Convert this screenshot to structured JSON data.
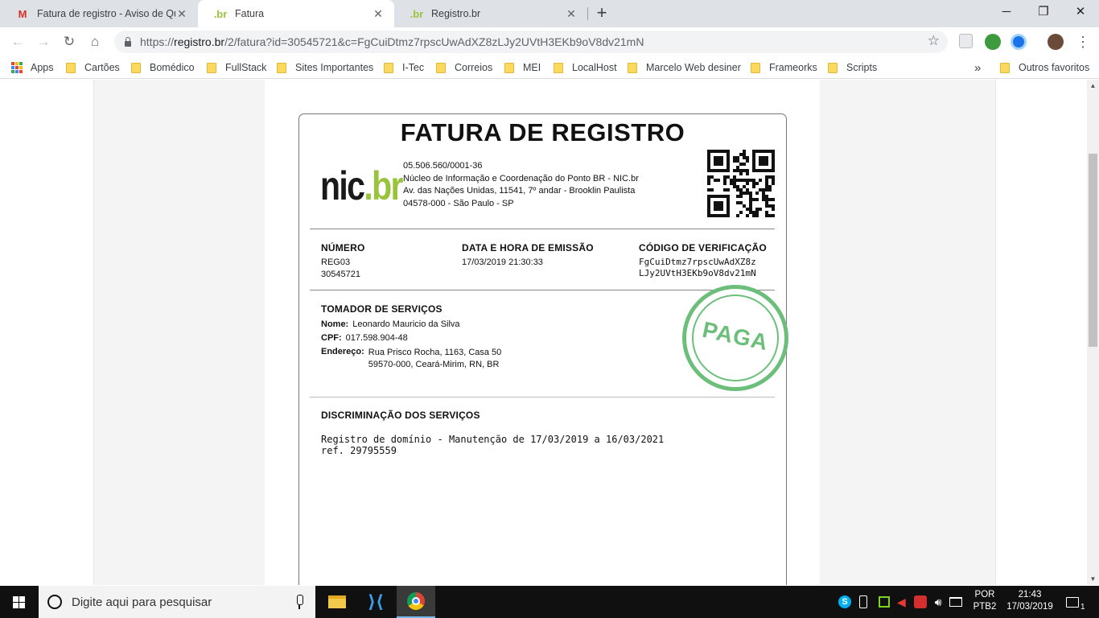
{
  "browser": {
    "tabs": [
      {
        "title": "Fatura de registro - Aviso de Quit",
        "icon": "gmail-icon",
        "active": false
      },
      {
        "title": "Fatura",
        "icon": "registro-br-icon",
        "active": true
      },
      {
        "title": "Registro.br",
        "icon": "registro-br-icon",
        "active": false
      }
    ],
    "url_prefix": "https://",
    "url_host": "registro.br",
    "url_path": "/2/fatura?id=30545721&c=FgCuiDtmz7rpscUwAdXZ8zLJy2UVtH3EKb9oV8dv21mN",
    "bookmarks": [
      "Apps",
      "Cartões",
      "Bomédico",
      "FullStack",
      "Sites Importantes",
      "I-Tec",
      "Correios",
      "MEI",
      "LocalHost",
      "Marcelo Web desiner",
      "Frameorks",
      "Scripts"
    ],
    "bookmarks_more": "»",
    "other_bookmarks": "Outros favoritos"
  },
  "invoice": {
    "title": "FATURA DE REGISTRO",
    "logo_text": "nic.br",
    "issuer": {
      "cnpj": "05.506.560/0001-36",
      "name": "Núcleo de Informação e Coordenação do Ponto BR - NIC.br",
      "address1": "Av. das Nações Unidas, 11541, 7º andar - Brooklin Paulista",
      "address2": "04578-000 - São Paulo - SP"
    },
    "numero_label": "NÚMERO",
    "numero_line1": "REG03",
    "numero_line2": "30545721",
    "data_label": "DATA E HORA DE EMISSÃO",
    "data_value": "17/03/2019 21:30:33",
    "codigo_label": "CÓDIGO DE VERIFICAÇÃO",
    "codigo_line1": "FgCuiDtmz7rpscUwAdXZ8z",
    "codigo_line2": "LJy2UVtH3EKb9oV8dv21mN",
    "tomador_label": "TOMADOR DE SERVIÇOS",
    "nome_label": "Nome:",
    "nome_value": "Leonardo Mauricio da Silva",
    "cpf_label": "CPF:",
    "cpf_value": "017.598.904-48",
    "endereco_label": "Endereço:",
    "endereco_line1": "Rua Prisco Rocha, 1163, Casa 50",
    "endereco_line2": "59570-000, Ceará-Mirim, RN, BR",
    "stamp": "PAGA",
    "discriminacao_label": "DISCRIMINAÇÃO DOS SERVIÇOS",
    "service_line1": "Registro de domínio - Manutenção de 17/03/2019 a 16/03/2021",
    "service_line2": "ref. 29795559"
  },
  "taskbar": {
    "search_placeholder": "Digite aqui para pesquisar",
    "lang_line1": "POR",
    "lang_line2": "PTB2",
    "time": "21:43",
    "date": "17/03/2019",
    "notification_count": "1"
  },
  "colors": {
    "accent_green": "#6cbf7b",
    "logo_green": "#9ac33c",
    "tabstrip": "#dee1e6"
  }
}
